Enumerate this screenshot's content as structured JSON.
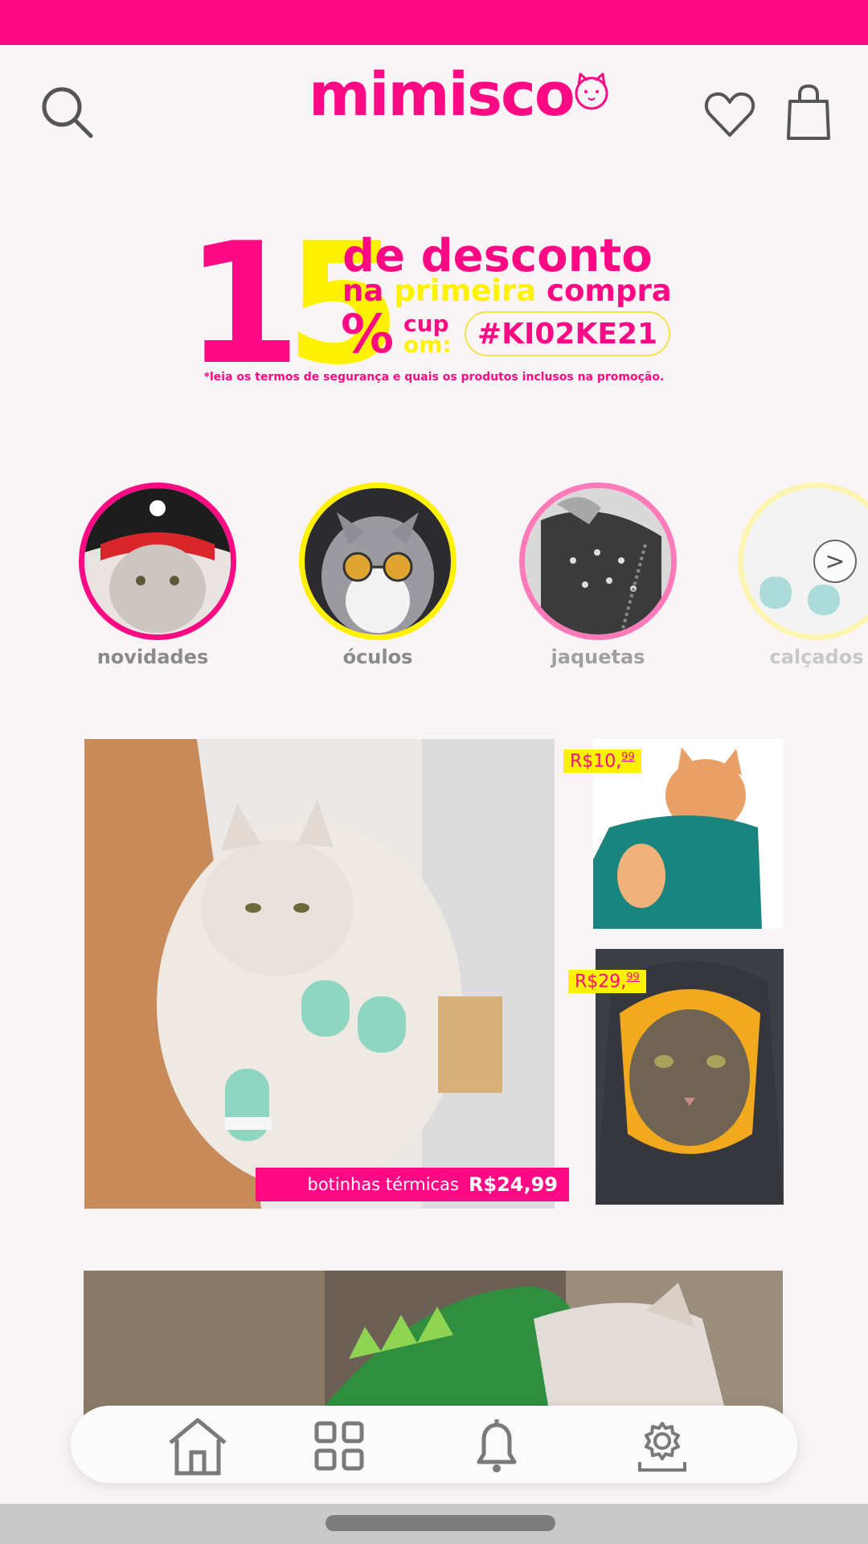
{
  "brand": {
    "name": "mimisco",
    "accent": "#ff0a84",
    "highlight": "#fff200"
  },
  "header": {
    "search_icon": "search-icon",
    "wishlist_icon": "heart-icon",
    "cart_icon": "shopping-bag-icon"
  },
  "promo": {
    "number_1": "1",
    "number_5": "5",
    "percent": "%",
    "line1": "de desconto",
    "line2_a": "na ",
    "line2_b": "primeira",
    "line2_c": " compra",
    "coupon_label_a": "cup",
    "coupon_label_b": "om:",
    "coupon_code": "#KI02KE21",
    "terms": "*leia os termos de segurança e quais os produtos inclusos na promoção."
  },
  "categories": [
    {
      "label": "novidades",
      "ring": "#ff0a84"
    },
    {
      "label": "óculos",
      "ring": "#fff200"
    },
    {
      "label": "jaquetas",
      "ring": "#ff7ab8"
    },
    {
      "label": "calçados",
      "ring": "#fdf5a6"
    }
  ],
  "carousel_next": ">",
  "products": {
    "featured": {
      "name": "botinhas térmicas",
      "price": "R$24,99"
    },
    "item1": {
      "price_main": "R$10,",
      "price_cents": "99"
    },
    "item2": {
      "price_main": "R$29,",
      "price_cents": "99"
    }
  },
  "bottom_nav": [
    {
      "icon": "home-icon"
    },
    {
      "icon": "grid-icon"
    },
    {
      "icon": "bell-icon"
    },
    {
      "icon": "settings-icon"
    }
  ]
}
